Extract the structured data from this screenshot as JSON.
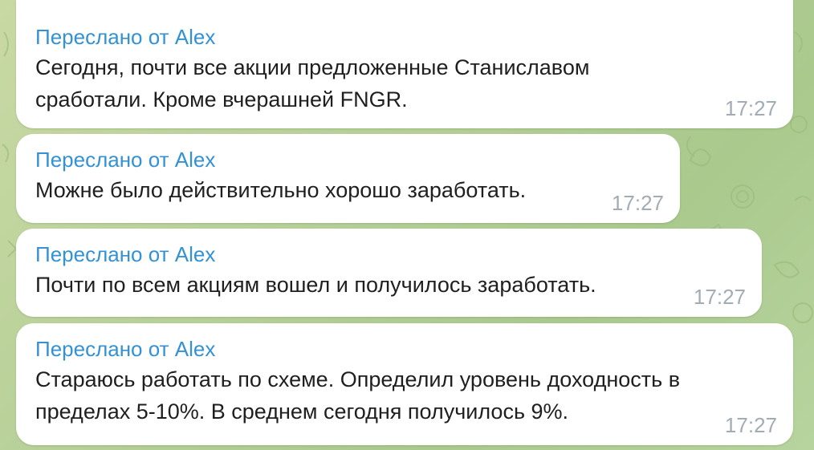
{
  "colors": {
    "background": "#b9d19a",
    "bubble": "#ffffff",
    "forwarded_label": "#3391d4",
    "message_text": "#1f1f1f",
    "timestamp": "#a2acb4"
  },
  "messages": [
    {
      "forwarded_from": "Переслано от Alex",
      "lines": [
        "Сегодня, почти все акции предложенные Станиславом",
        "сработали. Кроме вчерашней FNGR."
      ],
      "time": "17:27"
    },
    {
      "forwarded_from": "Переслано от Alex",
      "lines": [
        "Можне было действительно хорошо заработать."
      ],
      "time": "17:27"
    },
    {
      "forwarded_from": "Переслано от Alex",
      "lines": [
        "Почти по всем акциям вошел и получилось заработать."
      ],
      "time": "17:27"
    },
    {
      "forwarded_from": "Переслано от Alex",
      "lines": [
        "Стараюсь работать по схеме. Определил уровень доходность в",
        "пределах 5-10%. В среднем сегодня получилось 9%."
      ],
      "time": "17:27"
    }
  ]
}
